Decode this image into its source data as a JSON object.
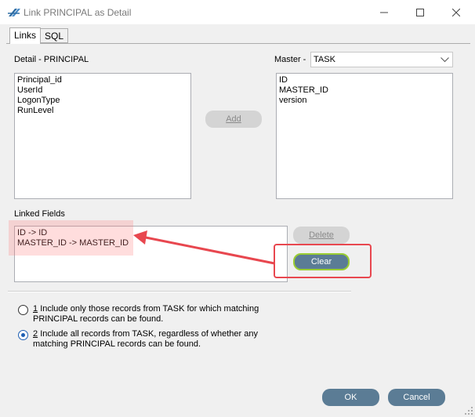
{
  "window": {
    "title": "Link PRINCIPAL as Detail"
  },
  "tabs": [
    {
      "label": "Links"
    },
    {
      "label": "SQL"
    }
  ],
  "detail": {
    "label": "Detail - PRINCIPAL",
    "fields": [
      "Principal_id",
      "UserId",
      "LogonType",
      "RunLevel"
    ]
  },
  "master": {
    "label": "Master -",
    "selected": "TASK",
    "fields": [
      "ID",
      "MASTER_ID",
      "version"
    ]
  },
  "buttons": {
    "add": "Add",
    "delete": "Delete",
    "clear": "Clear",
    "ok": "OK",
    "cancel": "Cancel"
  },
  "linked": {
    "label": "Linked Fields",
    "items": [
      "ID -> ID",
      "MASTER_ID -> MASTER_ID"
    ]
  },
  "options": [
    {
      "num": "1",
      "text": "Include only those records from TASK for which matching PRINCIPAL records can be found.",
      "selected": false
    },
    {
      "num": "2",
      "text": "Include all records from TASK, regardless of whether any matching PRINCIPAL records can be found.",
      "selected": true
    }
  ],
  "colors": {
    "accent": "#5b7c95",
    "annotation": "#e8474f",
    "clear_border": "#9acd32"
  }
}
